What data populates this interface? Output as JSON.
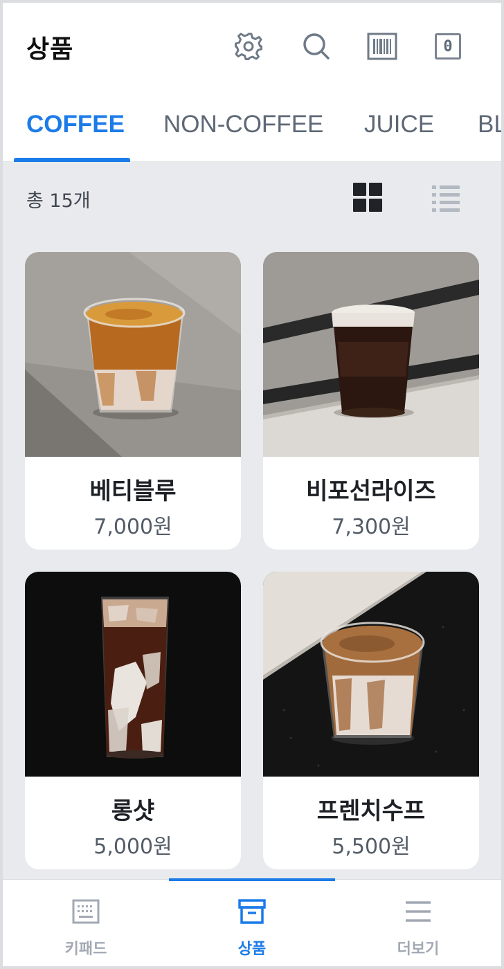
{
  "header": {
    "title": "상품",
    "icons": [
      "gear-icon",
      "search-icon",
      "barcode-icon",
      "cart-count"
    ],
    "cart_count": "0"
  },
  "tabs": [
    {
      "label": "COFFEE",
      "active": true
    },
    {
      "label": "NON-COFFEE",
      "active": false
    },
    {
      "label": "JUICE",
      "active": false
    },
    {
      "label": "BL",
      "active": false
    }
  ],
  "toolbar": {
    "total": "총 15개",
    "view_modes": [
      "grid-view-icon",
      "list-view-icon"
    ],
    "active_view": "grid"
  },
  "products": [
    {
      "name": "베티블루",
      "price": "7,000원"
    },
    {
      "name": "비포선라이즈",
      "price": "7,300원"
    },
    {
      "name": "롱샷",
      "price": "5,000원"
    },
    {
      "name": "프렌치수프",
      "price": "5,500원"
    }
  ],
  "bottom_nav": [
    {
      "label": "키패드",
      "icon": "keypad-icon",
      "active": false
    },
    {
      "label": "상품",
      "icon": "archive-box-icon",
      "active": true
    },
    {
      "label": "더보기",
      "icon": "menu-icon",
      "active": false
    }
  ],
  "colors": {
    "accent": "#1b7be8",
    "background": "#e9eaed",
    "text_dark": "#111111",
    "text_muted": "#5e6876"
  }
}
